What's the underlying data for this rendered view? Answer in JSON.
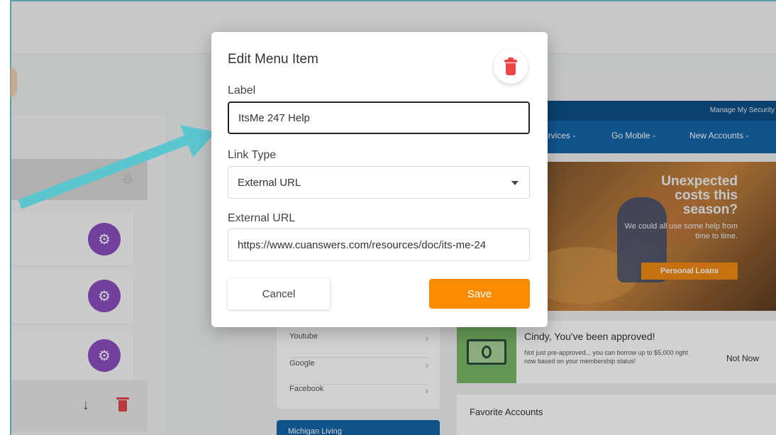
{
  "dialog": {
    "title": "Edit Menu Item",
    "label_field": {
      "label": "Label",
      "value": "ItsMe 247 Help"
    },
    "link_type_field": {
      "label": "Link Type",
      "value": "External URL"
    },
    "url_field": {
      "label": "External URL",
      "value": "https://www.cuanswers.com/resources/doc/its-me-24"
    },
    "cancel_label": "Cancel",
    "save_label": "Save",
    "delete_icon": "trash-icon"
  },
  "site": {
    "manage_link": "Manage My Security",
    "nav": [
      "ervices -",
      "Go Mobile -",
      "New Accounts -"
    ],
    "hero": {
      "title_line1": "Unexpected",
      "title_line2": "costs this",
      "title_line3": "season?",
      "subtitle": "We could all use some help from time to time.",
      "button": "Personal Loans"
    },
    "approval": {
      "title": "Cindy, You've been approved!",
      "text": "Not just pre-approved... you can borrow up to $5,000 right now based on your membership status!",
      "dismiss": "Not Now"
    },
    "links": [
      "Youtube",
      "Google",
      "Facebook"
    ],
    "favorites_title": "Favorite Accounts",
    "footer_card": "Michigan Living"
  },
  "editor": {
    "gear_icon": "gear-icon",
    "move_icon": "arrow-down-icon",
    "delete_icon": "trash-icon"
  },
  "colors": {
    "accent_purple": "#8a4fbf",
    "save_orange": "#fb8c00",
    "delete_red": "#ee4646",
    "annotation_teal": "#5cc6cf"
  }
}
